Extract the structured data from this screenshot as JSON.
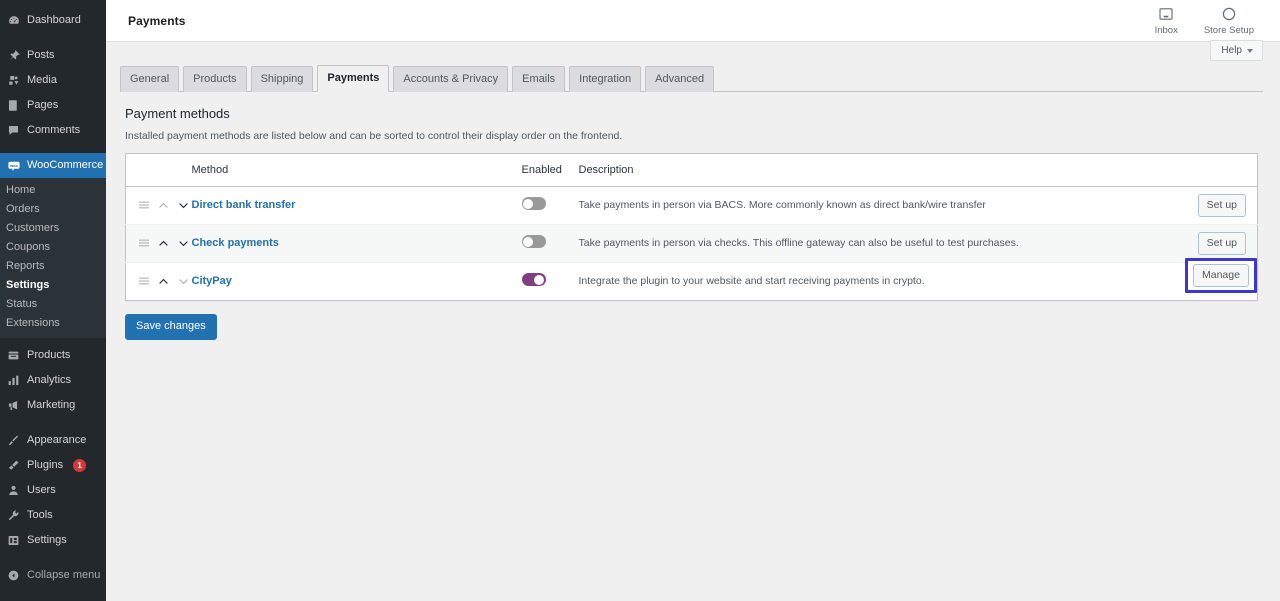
{
  "sidebar": {
    "top_items": [
      {
        "label": "Dashboard",
        "icon": "dashboard-icon"
      },
      {
        "label": "Posts",
        "icon": "pin-icon"
      },
      {
        "label": "Media",
        "icon": "media-icon"
      },
      {
        "label": "Pages",
        "icon": "pages-icon"
      },
      {
        "label": "Comments",
        "icon": "comments-icon"
      }
    ],
    "woocommerce": {
      "label": "WooCommerce",
      "icon": "woocommerce-icon"
    },
    "woo_submenu": [
      {
        "label": "Home",
        "current": false
      },
      {
        "label": "Orders",
        "current": false
      },
      {
        "label": "Customers",
        "current": false
      },
      {
        "label": "Coupons",
        "current": false
      },
      {
        "label": "Reports",
        "current": false
      },
      {
        "label": "Settings",
        "current": true
      },
      {
        "label": "Status",
        "current": false
      },
      {
        "label": "Extensions",
        "current": false
      }
    ],
    "mid_items": [
      {
        "label": "Products",
        "icon": "products-icon"
      },
      {
        "label": "Analytics",
        "icon": "analytics-icon"
      },
      {
        "label": "Marketing",
        "icon": "marketing-icon"
      }
    ],
    "bottom_items": [
      {
        "label": "Appearance",
        "icon": "appearance-icon",
        "badge": ""
      },
      {
        "label": "Plugins",
        "icon": "plugins-icon",
        "badge": "1"
      },
      {
        "label": "Users",
        "icon": "users-icon",
        "badge": ""
      },
      {
        "label": "Tools",
        "icon": "tools-icon",
        "badge": ""
      },
      {
        "label": "Settings",
        "icon": "settings-icon",
        "badge": ""
      }
    ],
    "collapse": {
      "label": "Collapse menu",
      "icon": "collapse-icon"
    }
  },
  "header": {
    "title": "Payments",
    "inbox": {
      "label": "Inbox",
      "icon": "inbox-icon"
    },
    "store_setup": {
      "label": "Store Setup",
      "icon": "circle-progress-icon"
    },
    "help": {
      "label": "Help",
      "icon": "chevron-down-icon"
    }
  },
  "tabs": [
    {
      "label": "General",
      "active": false
    },
    {
      "label": "Products",
      "active": false
    },
    {
      "label": "Shipping",
      "active": false
    },
    {
      "label": "Payments",
      "active": true
    },
    {
      "label": "Accounts & Privacy",
      "active": false
    },
    {
      "label": "Emails",
      "active": false
    },
    {
      "label": "Integration",
      "active": false
    },
    {
      "label": "Advanced",
      "active": false
    }
  ],
  "section": {
    "title": "Payment methods",
    "description": "Installed payment methods are listed below and can be sorted to control their display order on the frontend."
  },
  "table": {
    "columns": {
      "sort": "",
      "method": "Method",
      "enabled": "Enabled",
      "description": "Description",
      "action": ""
    },
    "rows": [
      {
        "method": "Direct bank transfer",
        "enabled": false,
        "description": "Take payments in person via BACS. More commonly known as direct bank/wire transfer",
        "action": "Set up",
        "up_disabled": true,
        "down_disabled": false,
        "highlighted": false
      },
      {
        "method": "Check payments",
        "enabled": false,
        "description": "Take payments in person via checks. This offline gateway can also be useful to test purchases.",
        "action": "Set up",
        "up_disabled": false,
        "down_disabled": false,
        "highlighted": false
      },
      {
        "method": "CityPay",
        "enabled": true,
        "description": "Integrate the plugin to your website and start receiving payments in crypto.",
        "action": "Manage",
        "up_disabled": false,
        "down_disabled": true,
        "highlighted": true
      }
    ]
  },
  "footer": {
    "save_label": "Save changes"
  },
  "colors": {
    "wp_blue": "#2271b1",
    "sidebar_bg": "#23282d",
    "toggle_on": "#7f3f7f",
    "badge_red": "#d63638",
    "highlight": "#3c37d2"
  }
}
